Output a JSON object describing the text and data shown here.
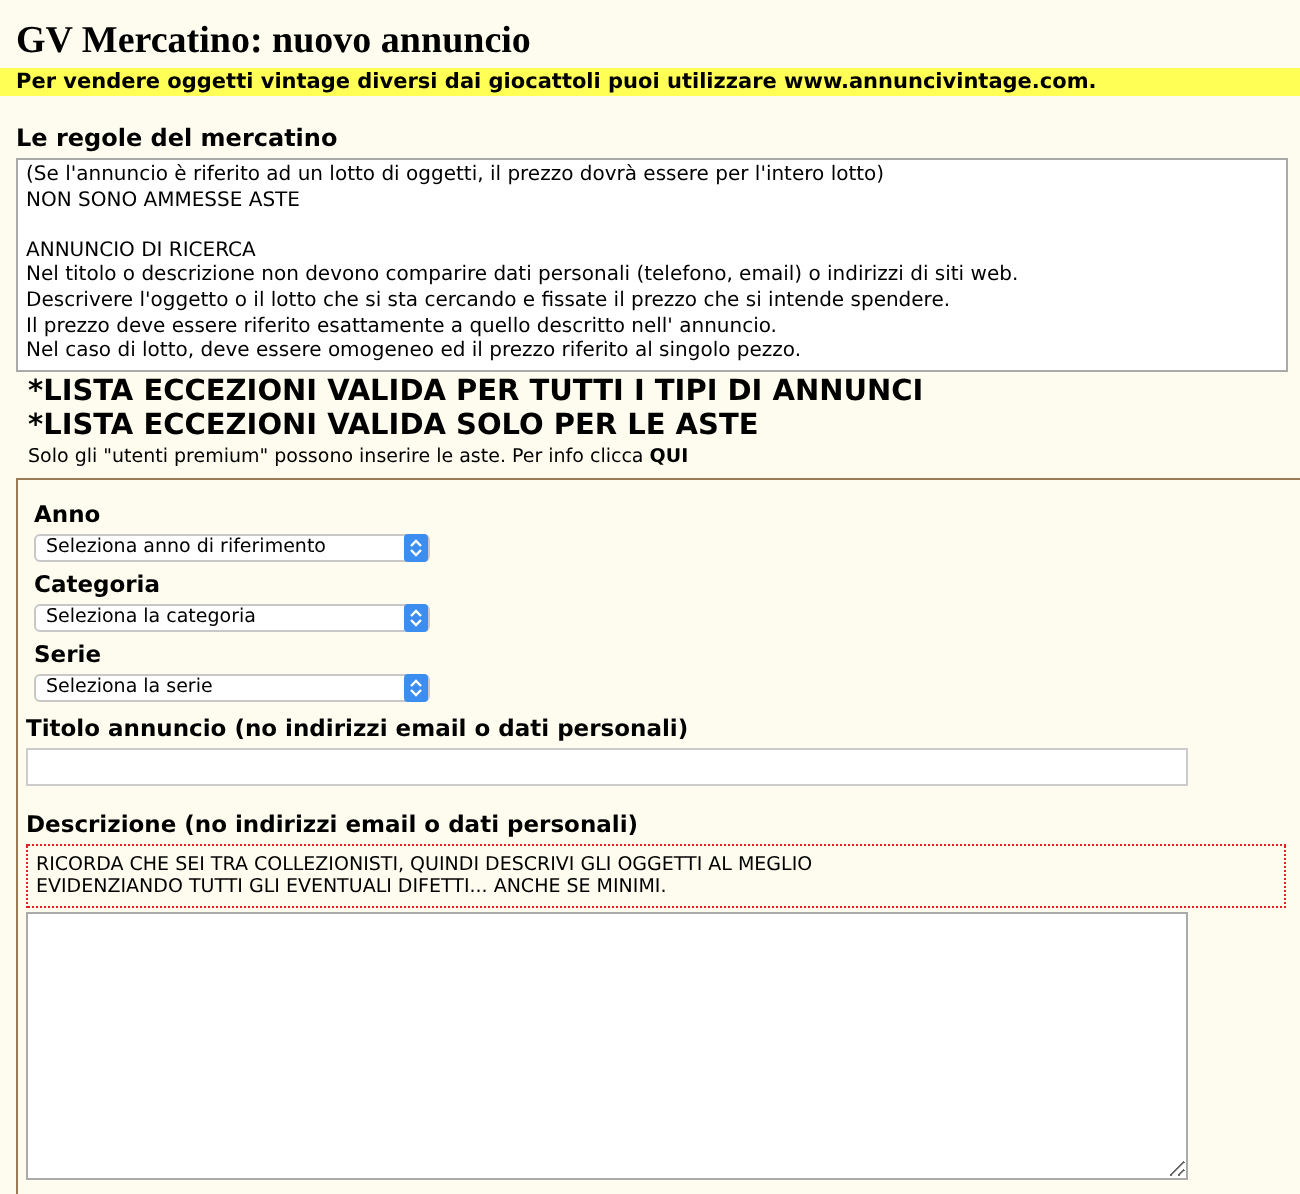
{
  "title": "GV Mercatino: nuovo annuncio",
  "notice": "Per vendere oggetti vintage diversi dai giocattoli puoi utilizzare www.annuncivintage.com.",
  "rules": {
    "heading": "Le regole del mercatino",
    "paragraphs": [
      [
        "(Se l'annuncio è riferito ad un lotto di oggetti, il prezzo dovrà essere per l'intero lotto)",
        "NON SONO AMMESSE ASTE"
      ],
      [
        "ANNUNCIO DI RICERCA",
        "Nel titolo o descrizione non devono comparire dati personali (telefono, email) o indirizzi di siti web.",
        "Descrivere l'oggetto o il lotto che si sta cercando e fissate il prezzo che si intende spendere.",
        "Il prezzo deve essere riferito esattamente a quello descritto nell' annuncio.",
        "Nel caso di lotto, deve essere omogeneo ed il prezzo riferito al singolo pezzo."
      ]
    ]
  },
  "exception_links": [
    "*LISTA ECCEZIONI VALIDA PER TUTTI I TIPI DI ANNUNCI",
    "*LISTA ECCEZIONI VALIDA SOLO PER LE ASTE"
  ],
  "premium_note": {
    "text": "Solo gli \"utenti premium\" possono inserire le aste. Per info clicca",
    "link": "QUI"
  },
  "fields": [
    {
      "kind": "select",
      "label": "Anno",
      "value": "Seleziona anno di riferimento"
    },
    {
      "kind": "select",
      "label": "Categoria",
      "value": "Seleziona la categoria"
    },
    {
      "kind": "select",
      "label": "Serie",
      "value": "Seleziona la serie"
    },
    {
      "kind": "text",
      "label": "Titolo annuncio (no indirizzi email o dati personali)"
    },
    {
      "kind": "textarea",
      "label": "Descrizione (no indirizzi email o dati personali)",
      "hint": "RICORDA CHE SEI TRA COLLEZIONISTI, QUINDI DESCRIVI GLI OGGETTI AL MEGLIO\nEVIDENZIANDO TUTTI GLI EVENTUALI DIFETTI... ANCHE SE MINIMI."
    }
  ]
}
